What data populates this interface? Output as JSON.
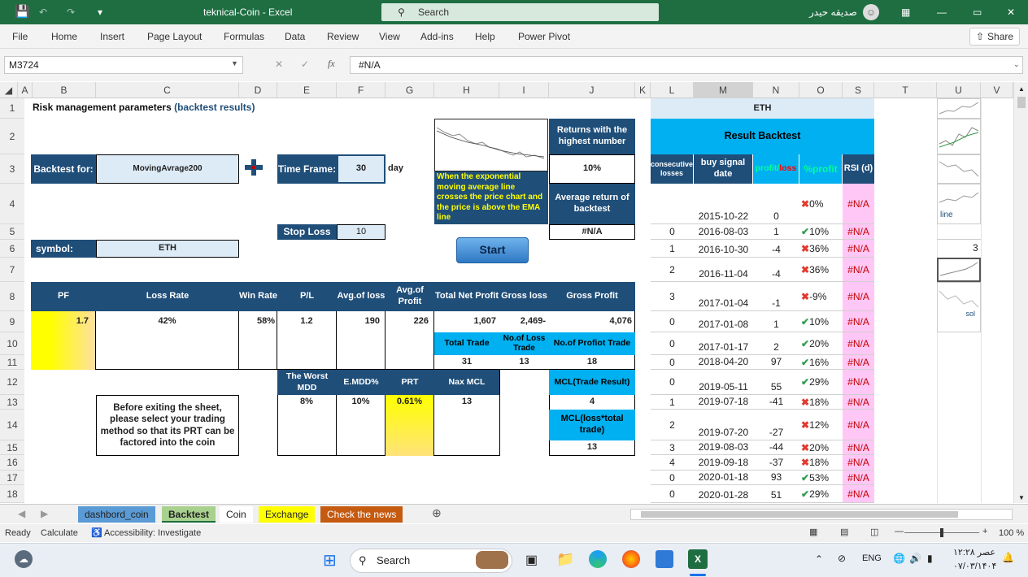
{
  "window": {
    "title": "teknical-Coin  -  Excel",
    "search_label": "Search",
    "user": "صديقه حيدر"
  },
  "menu": [
    "File",
    "Home",
    "Insert",
    "Page Layout",
    "Formulas",
    "Data",
    "Review",
    "View",
    "Add-ins",
    "Help",
    "Power Pivot"
  ],
  "share_label": "Share",
  "name_box": "M3724",
  "formula": "#N/A",
  "fx_label": "fx",
  "columns": [
    "A",
    "B",
    "C",
    "D",
    "E",
    "F",
    "G",
    "H",
    "I",
    "J",
    "K",
    "L",
    "M",
    "N",
    "O",
    "S",
    "T",
    "U",
    "V"
  ],
  "rows": [
    "1",
    "2",
    "3",
    "4",
    "5",
    "6",
    "7",
    "8",
    "9",
    "10",
    "11",
    "12",
    "13",
    "14",
    "15",
    "16",
    "17",
    "18"
  ],
  "sheet": {
    "title": "Risk management parameters ",
    "title_paren": "(backtest results)",
    "backtest_for_label": "Backtest for:",
    "backtest_for_value": "MovingAvrage200",
    "timeframe_label": "Time Frame:",
    "timeframe_value": "30",
    "timeframe_unit": "day",
    "stoploss_label": "Stop Loss",
    "stoploss_value": "10",
    "symbol_label": "symbol:",
    "symbol_value": "ETH",
    "ema_note": "When the exponential moving average line crosses the price chart and the price is above the EMA line",
    "returns_label": "Returns with the highest number",
    "returns_value": "10%",
    "avg_return_label": "Average return of backtest",
    "avg_return_value": "#N/A",
    "start_button": "Start",
    "stats_headers": [
      "PF",
      "Loss Rate",
      "Win Rate",
      "P/L",
      "Avg.of loss",
      "Avg.of Profit",
      "Total Net Profit",
      "Gross loss",
      "Gross Profit"
    ],
    "stats_values": [
      "1.7",
      "42%",
      "58%",
      "1.2",
      "190",
      "226",
      "1,607",
      "2,469-",
      "4,076"
    ],
    "trade_headers": [
      "Total Trade",
      "No.of Loss Trade",
      "No.of Profiot Trade"
    ],
    "trade_values": [
      "31",
      "13",
      "18"
    ],
    "risk_headers": [
      "The Worst MDD",
      "E.MDD%",
      "PRT",
      "Nax MCL"
    ],
    "risk_values": [
      "8%",
      "10%",
      "0.61%",
      "13"
    ],
    "mcl_trade_label": "MCL(Trade Result)",
    "mcl_trade_value": "4",
    "mcl_loss_label": "MCL(loss*total trade)",
    "mcl_loss_value": "13",
    "note": "Before exiting the sheet, please select your trading method so that its PRT can be factored into the coin"
  },
  "result": {
    "symbol": "ETH",
    "title": "Result Backtest",
    "headers": [
      "consecutive losses",
      "buy signal date",
      "profit/loss",
      "%profit",
      "RSI (d)"
    ],
    "header_profit": "profit/",
    "header_loss": "loss",
    "rows": [
      {
        "c": "",
        "d": "2015-10-22",
        "p": "0",
        "pct": "0%",
        "ok": false,
        "rsi": "#N/A"
      },
      {
        "c": "0",
        "d": "2016-08-03",
        "p": "1",
        "pct": "10%",
        "ok": true,
        "rsi": "#N/A"
      },
      {
        "c": "1",
        "d": "2016-10-30",
        "p": "-4",
        "pct": "36%",
        "ok": false,
        "rsi": "#N/A"
      },
      {
        "c": "2",
        "d": "2016-11-04",
        "p": "-4",
        "pct": "36%",
        "ok": false,
        "rsi": "#N/A"
      },
      {
        "c": "3",
        "d": "2017-01-04",
        "p": "-1",
        "pct": "-9%",
        "ok": false,
        "rsi": "#N/A"
      },
      {
        "c": "0",
        "d": "2017-01-08",
        "p": "1",
        "pct": "10%",
        "ok": true,
        "rsi": "#N/A"
      },
      {
        "c": "0",
        "d": "2017-01-17",
        "p": "2",
        "pct": "20%",
        "ok": true,
        "rsi": "#N/A"
      },
      {
        "c": "0",
        "d": "2018-04-20",
        "p": "97",
        "pct": "16%",
        "ok": true,
        "rsi": "#N/A"
      },
      {
        "c": "0",
        "d": "2019-05-11",
        "p": "55",
        "pct": "29%",
        "ok": true,
        "rsi": "#N/A"
      },
      {
        "c": "1",
        "d": "2019-07-18",
        "p": "-41",
        "pct": "18%",
        "ok": false,
        "rsi": "#N/A"
      },
      {
        "c": "2",
        "d": "2019-07-20",
        "p": "-27",
        "pct": "12%",
        "ok": false,
        "rsi": "#N/A"
      },
      {
        "c": "3",
        "d": "2019-08-03",
        "p": "-44",
        "pct": "20%",
        "ok": false,
        "rsi": "#N/A"
      },
      {
        "c": "4",
        "d": "2019-09-18",
        "p": "-37",
        "pct": "18%",
        "ok": false,
        "rsi": "#N/A"
      },
      {
        "c": "0",
        "d": "2020-01-18",
        "p": "93",
        "pct": "53%",
        "ok": true,
        "rsi": "#N/A"
      },
      {
        "c": "0",
        "d": "2020-01-28",
        "p": "51",
        "pct": "29%",
        "ok": true,
        "rsi": "#N/A"
      }
    ]
  },
  "side": {
    "line_label": "line",
    "three": "3",
    "sol_label": "sol"
  },
  "tabs": [
    {
      "label": "dashbord_coin",
      "color": "#5b9bd5"
    },
    {
      "label": "Backtest",
      "color": "#a9d18e"
    },
    {
      "label": "Coin",
      "color": "#ffffff"
    },
    {
      "label": "Exchange",
      "color": "#ffff00"
    },
    {
      "label": "Check the news",
      "color": "#c55a11"
    }
  ],
  "status": {
    "ready": "Ready",
    "calculate": "Calculate",
    "accessibility": "Accessibility: Investigate",
    "zoom": "100 %"
  },
  "taskbar": {
    "search": "Search",
    "lang": "ENG",
    "time": "۱۲:۲۸ عصر",
    "date": "۰۷/۰۳/۱۴۰۴"
  }
}
